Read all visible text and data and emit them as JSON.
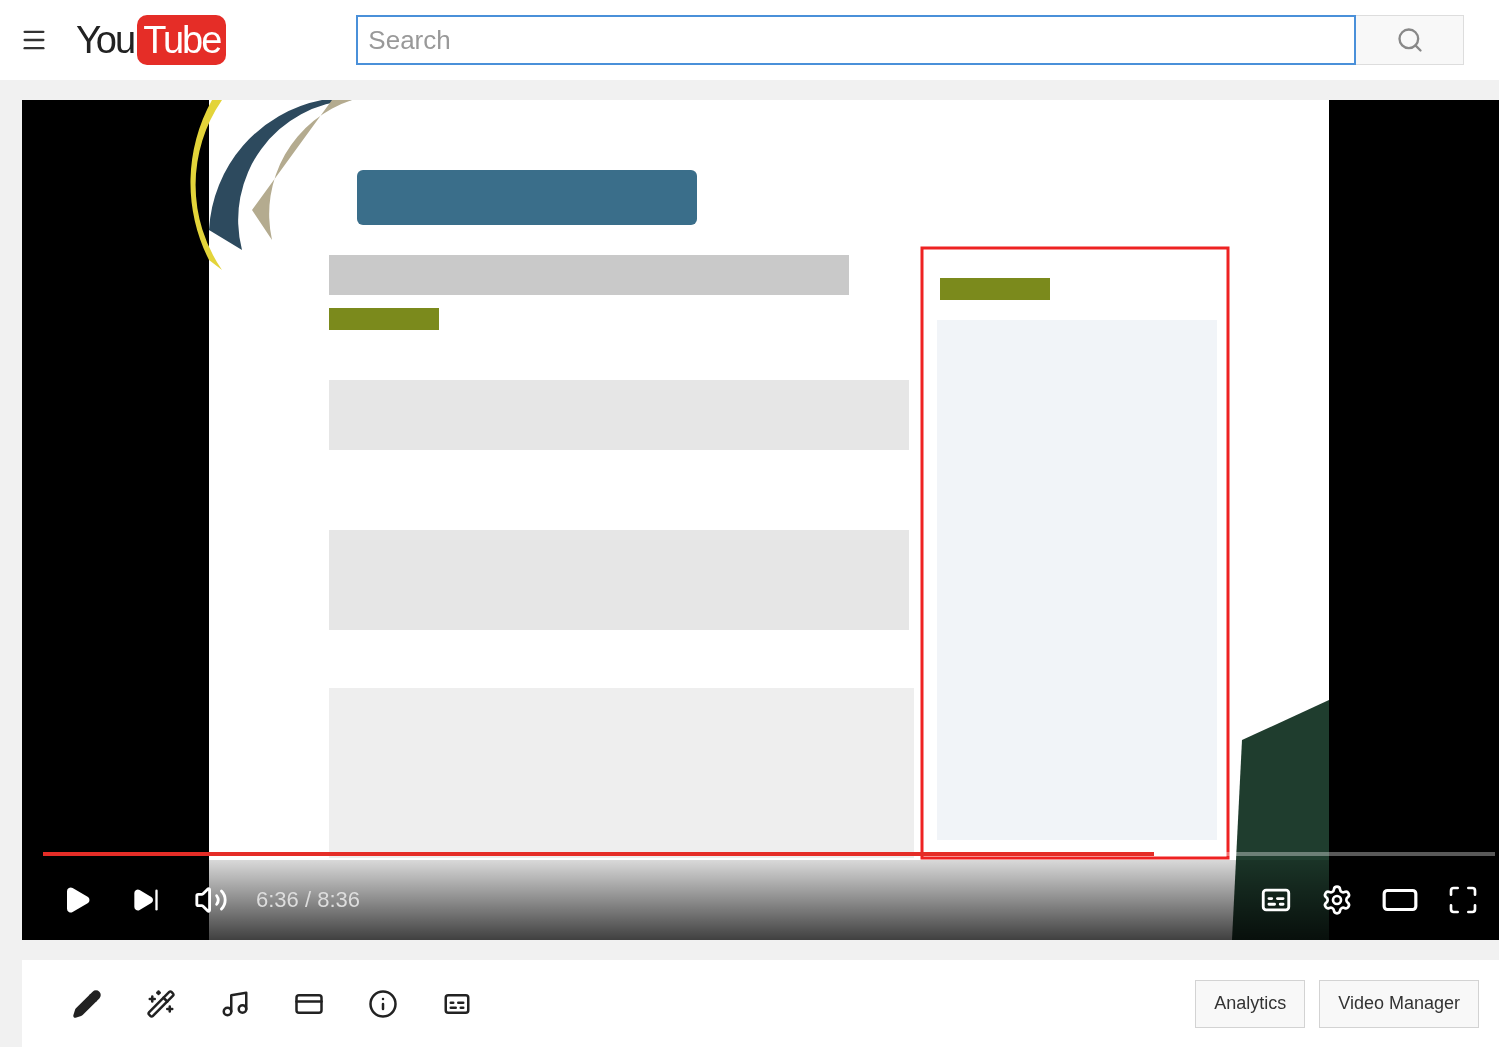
{
  "header": {
    "logo": {
      "you": "You",
      "tube": "Tube"
    },
    "search": {
      "placeholder": "Search"
    }
  },
  "player": {
    "progress": {
      "level": 0.765
    },
    "time": "6:36 / 8:36"
  },
  "toolbar": {
    "tools": [
      {
        "kind": "pencil"
      },
      {
        "kind": "wand"
      },
      {
        "kind": "music"
      },
      {
        "kind": "card"
      },
      {
        "kind": "info"
      },
      {
        "kind": "captions"
      }
    ],
    "buttons": [
      "Analytics",
      "Video Manager"
    ]
  }
}
